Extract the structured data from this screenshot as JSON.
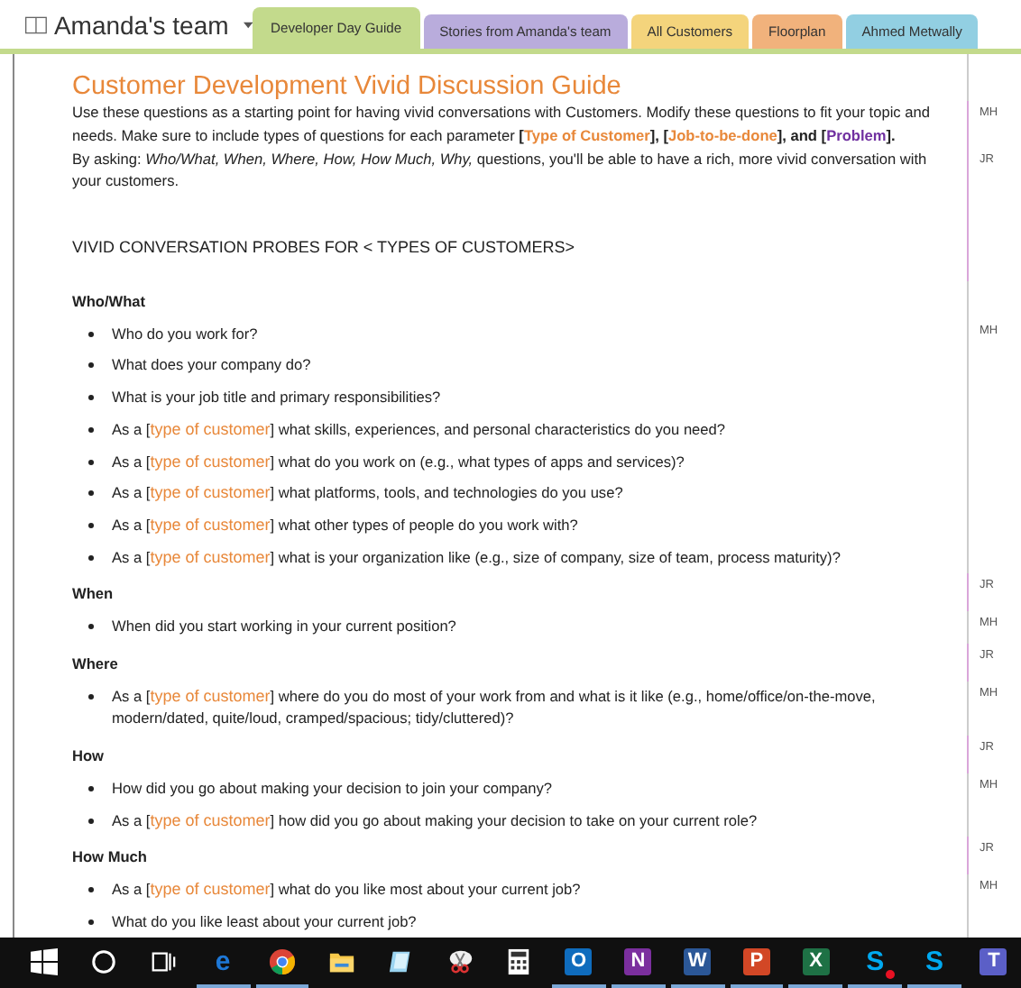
{
  "notebook": {
    "title": "Amanda's team"
  },
  "tabs": [
    {
      "label": "Developer Day Guide",
      "color": "#c3da8c",
      "selected": true
    },
    {
      "label": "Stories from Amanda's team",
      "color": "#b9acdc",
      "selected": false
    },
    {
      "label": "All Customers",
      "color": "#f4d47c",
      "selected": false
    },
    {
      "label": "Floorplan",
      "color": "#f1b27c",
      "selected": false
    },
    {
      "label": "Ahmed Metwally",
      "color": "#92cfe2",
      "selected": false
    }
  ],
  "page": {
    "title": "Customer Development Vivid Discussion Guide",
    "blocks": [
      {
        "kind": "paragraph",
        "author": "MH",
        "segments": [
          {
            "kind": "plain",
            "text": "Use these questions as a starting point for having vivid conversations with Customers. Modify these questions to fit your topic and needs. Make sure to include types of questions for each parameter "
          },
          {
            "kind": "bold",
            "text": "["
          },
          {
            "kind": "field",
            "color": "#e8883a",
            "text": "Type of Customer"
          },
          {
            "kind": "bold",
            "text": "], ["
          },
          {
            "kind": "field",
            "color": "#e8883a",
            "text": "Job-to-be-done"
          },
          {
            "kind": "bold",
            "text": "], and ["
          },
          {
            "kind": "field",
            "color": "#7030a0",
            "text": "Problem"
          },
          {
            "kind": "bold",
            "text": "]."
          }
        ]
      },
      {
        "kind": "paragraph",
        "author": "JR",
        "segments": [
          {
            "kind": "plain",
            "text": " By asking: "
          },
          {
            "kind": "italic",
            "text": "Who/What, When, Where, How, How Much, Why,"
          },
          {
            "kind": "plain",
            "text": " questions, you'll be able to have a rich, more vivid conversation with your customers."
          }
        ]
      },
      {
        "kind": "section",
        "segments": [
          {
            "kind": "plain",
            "text": "VIVID CONVERSATION PROBES FOR < TYPES OF CUSTOMERS>"
          }
        ]
      },
      {
        "kind": "heading",
        "segments": [
          {
            "kind": "plain",
            "text": "Who/What"
          }
        ]
      },
      {
        "kind": "bullet",
        "author": "MH",
        "segments": [
          {
            "kind": "plain",
            "text": "Who do you work for?"
          }
        ]
      },
      {
        "kind": "bullet",
        "segments": [
          {
            "kind": "plain",
            "text": "What does your company do?"
          }
        ]
      },
      {
        "kind": "bullet",
        "segments": [
          {
            "kind": "plain",
            "text": "What is your job title and primary responsibilities?"
          }
        ]
      },
      {
        "kind": "bullet",
        "segments": [
          {
            "kind": "plain",
            "text": "As a ["
          },
          {
            "kind": "field",
            "color": "#e8883a",
            "text": "type of customer"
          },
          {
            "kind": "plain",
            "text": "] what skills, experiences, and personal characteristics do you need?"
          }
        ]
      },
      {
        "kind": "bullet",
        "segments": [
          {
            "kind": "plain",
            "text": "As a ["
          },
          {
            "kind": "field",
            "color": "#e8883a",
            "text": "type of customer"
          },
          {
            "kind": "plain",
            "text": "] what do you work on (e.g., what types of apps and services)?"
          }
        ]
      },
      {
        "kind": "bullet",
        "segments": [
          {
            "kind": "plain",
            "text": "As a ["
          },
          {
            "kind": "field",
            "color": "#e8883a",
            "text": "type of customer"
          },
          {
            "kind": "plain",
            "text": "] what platforms, tools, and technologies do you use?"
          }
        ]
      },
      {
        "kind": "bullet",
        "segments": [
          {
            "kind": "plain",
            "text": "As a ["
          },
          {
            "kind": "field",
            "color": "#e8883a",
            "text": "type of customer"
          },
          {
            "kind": "plain",
            "text": "] what other types of people do you work with?"
          }
        ]
      },
      {
        "kind": "bullet",
        "segments": [
          {
            "kind": "plain",
            "text": "As a ["
          },
          {
            "kind": "field",
            "color": "#e8883a",
            "text": "type of customer"
          },
          {
            "kind": "plain",
            "text": "] what is your organization like (e.g., size of company, size of team, process maturity)?"
          }
        ]
      },
      {
        "kind": "heading",
        "author": "JR",
        "segments": [
          {
            "kind": "plain",
            "text": "When"
          }
        ]
      },
      {
        "kind": "bullet",
        "author": "MH",
        "segments": [
          {
            "kind": "plain",
            "text": "When did you start working in your current position?"
          }
        ]
      },
      {
        "kind": "heading",
        "author": "JR",
        "segments": [
          {
            "kind": "plain",
            "text": "Where"
          }
        ]
      },
      {
        "kind": "bullet",
        "author": "MH",
        "segments": [
          {
            "kind": "plain",
            "text": "As a ["
          },
          {
            "kind": "field",
            "color": "#e8883a",
            "text": "type of customer"
          },
          {
            "kind": "plain",
            "text": "] where do you do most of your work from and what is it like (e.g., home/office/on-the-move, modern/dated, quite/loud, cramped/spacious; tidy/cluttered)?"
          }
        ]
      },
      {
        "kind": "heading",
        "author": "JR",
        "segments": [
          {
            "kind": "plain",
            "text": "How"
          }
        ]
      },
      {
        "kind": "bullet",
        "author": "MH",
        "segments": [
          {
            "kind": "plain",
            "text": "How did you go about making your decision to join your company?"
          }
        ]
      },
      {
        "kind": "bullet",
        "segments": [
          {
            "kind": "plain",
            "text": "As a ["
          },
          {
            "kind": "field",
            "color": "#e8883a",
            "text": "type of customer"
          },
          {
            "kind": "plain",
            "text": "] how did you go about making your decision to take on your current role?"
          }
        ]
      },
      {
        "kind": "heading",
        "author": "JR",
        "segments": [
          {
            "kind": "plain",
            "text": "How Much"
          }
        ]
      },
      {
        "kind": "bullet",
        "author": "MH",
        "segments": [
          {
            "kind": "plain",
            "text": "As a ["
          },
          {
            "kind": "field",
            "color": "#e8883a",
            "text": "type of customer"
          },
          {
            "kind": "plain",
            "text": "] what do you like most about your current job?"
          }
        ]
      },
      {
        "kind": "bullet",
        "segments": [
          {
            "kind": "plain",
            "text": "What do you like least about your current job?"
          }
        ]
      }
    ]
  },
  "taskbar": [
    {
      "kind": "start",
      "running": false
    },
    {
      "kind": "search",
      "running": false
    },
    {
      "kind": "taskview",
      "running": false
    },
    {
      "kind": "app",
      "glyph": "e",
      "color": "#1e78d7",
      "tile": false,
      "running": true
    },
    {
      "kind": "chrome",
      "running": true
    },
    {
      "kind": "folder",
      "running": false
    },
    {
      "kind": "notes",
      "running": false
    },
    {
      "kind": "snip",
      "running": false
    },
    {
      "kind": "calculator",
      "running": false
    },
    {
      "kind": "app",
      "glyph": "O",
      "color": "#0f6cbd",
      "tile": true,
      "running": true
    },
    {
      "kind": "app",
      "glyph": "N",
      "color": "#7b2f9e",
      "tile": true,
      "running": true
    },
    {
      "kind": "app",
      "glyph": "W",
      "color": "#2b5797",
      "tile": true,
      "running": true
    },
    {
      "kind": "app",
      "glyph": "P",
      "color": "#d24726",
      "tile": true,
      "running": true
    },
    {
      "kind": "app",
      "glyph": "X",
      "color": "#1e7145",
      "tile": true,
      "running": true
    },
    {
      "kind": "app",
      "glyph": "S",
      "color": "#00a9f0",
      "tile": false,
      "badge": true,
      "running": true
    },
    {
      "kind": "app",
      "glyph": "S",
      "color": "#00a9f0",
      "tile": false,
      "running": true
    },
    {
      "kind": "app",
      "glyph": "T",
      "color": "#5b5fc7",
      "tile": true,
      "running": false
    }
  ]
}
